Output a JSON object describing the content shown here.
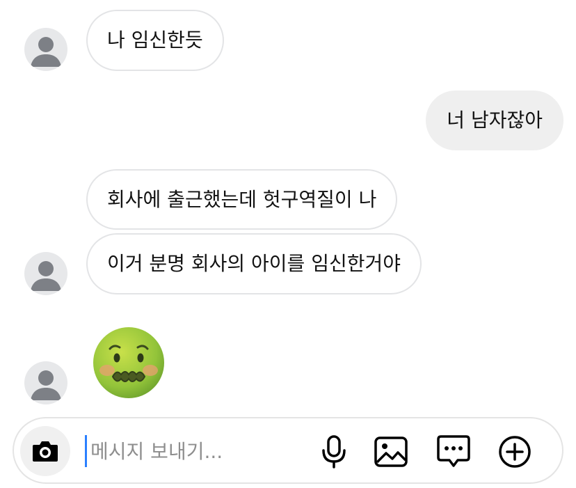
{
  "messages": [
    {
      "sender": "other",
      "text": "나 임신한듯"
    },
    {
      "sender": "me",
      "text": "너 남자잖아"
    },
    {
      "sender": "other",
      "text": "회사에 출근했는데 헛구역질이 나"
    },
    {
      "sender": "other",
      "text": "이거 분명 회사의 아이를 임신한거야"
    },
    {
      "sender": "other",
      "emoji": "nauseated-face"
    }
  ],
  "composer": {
    "placeholder": "메시지 보내기..."
  },
  "icons": {
    "camera": "camera-icon",
    "microphone": "microphone-icon",
    "gallery": "image-icon",
    "sticker": "chat-bubble-icon",
    "add": "plus-circle-icon"
  },
  "colors": {
    "accent": "#2b80ff",
    "bubble_out": "#efefef",
    "bubble_in_border": "#e3e4e6",
    "emoji_face": "#9ccc3a"
  }
}
